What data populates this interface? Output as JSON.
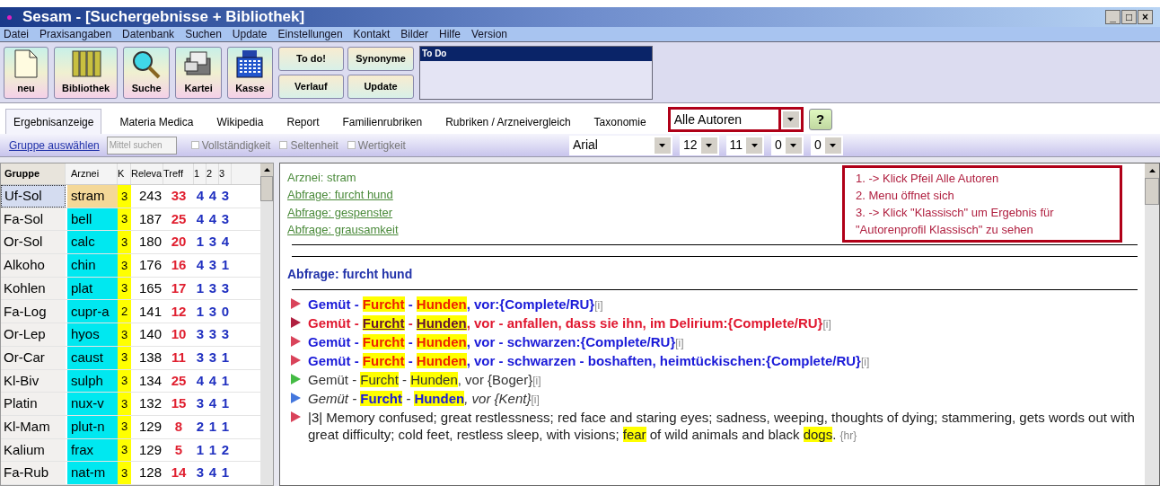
{
  "window": {
    "title": "Sesam - [Suchergebnisse + Bibliothek]",
    "controls": [
      "_",
      "□",
      "×"
    ]
  },
  "menu": [
    "Datei",
    "Praxisangaben",
    "Datenbank",
    "Suchen",
    "Update",
    "Einstellungen",
    "Kontakt",
    "Bilder",
    "Hilfe",
    "Version"
  ],
  "toolbar": {
    "big_buttons": [
      {
        "label": "neu",
        "kind": "page"
      },
      {
        "label": "Bibliothek",
        "kind": "books"
      },
      {
        "label": "Suche",
        "kind": "magnifier"
      },
      {
        "label": "Kartei",
        "kind": "cards"
      },
      {
        "label": "Kasse",
        "kind": "register"
      }
    ],
    "small_buttons": [
      "To do!",
      "Synonyme",
      "Verlauf",
      "Update"
    ],
    "todo_title": "To Do"
  },
  "tabs": [
    {
      "label": "Ergebnisanzeige",
      "selected": true
    },
    {
      "label": "Materia Medica",
      "selected": false
    },
    {
      "label": "Wikipedia",
      "selected": false
    },
    {
      "label": "Report",
      "selected": false
    },
    {
      "label": "Familienrubriken",
      "selected": false
    },
    {
      "label": "Rubriken / Arzneivergleich",
      "selected": false
    },
    {
      "label": "Taxonomie",
      "selected": false
    }
  ],
  "author_select": {
    "value": "Alle Autoren",
    "help": "?"
  },
  "subbar": {
    "link": "Gruppe auswählen",
    "search_placeholder": "Mittel suchen",
    "checkboxes": [
      {
        "label": "Vollständigkeit",
        "checked": false
      },
      {
        "label": "Seltenheit",
        "checked": false
      },
      {
        "label": "Wertigkeit",
        "checked": false
      }
    ],
    "font": "Arial",
    "selects": [
      "12",
      "11",
      "0",
      "0"
    ]
  },
  "table": {
    "columns": [
      "Gruppe",
      "Arznei",
      "K",
      "Releva",
      "Treff",
      "1",
      "2",
      "3"
    ],
    "rows": [
      {
        "gruppe": "Uf-Sol",
        "arznei": "stram",
        "k": "3",
        "releva": "243",
        "treff": "33",
        "c1": "4",
        "c2": "4",
        "c3": "3",
        "selected": true
      },
      {
        "gruppe": "Fa-Sol",
        "arznei": "bell",
        "k": "3",
        "releva": "187",
        "treff": "25",
        "c1": "4",
        "c2": "4",
        "c3": "3",
        "selected": false
      },
      {
        "gruppe": "Or-Sol",
        "arznei": "calc",
        "k": "3",
        "releva": "180",
        "treff": "20",
        "c1": "1",
        "c2": "3",
        "c3": "4",
        "selected": false
      },
      {
        "gruppe": "Alkoho",
        "arznei": "chin",
        "k": "3",
        "releva": "176",
        "treff": "16",
        "c1": "4",
        "c2": "3",
        "c3": "1",
        "selected": false
      },
      {
        "gruppe": "Kohlen",
        "arznei": "plat",
        "k": "3",
        "releva": "165",
        "treff": "17",
        "c1": "1",
        "c2": "3",
        "c3": "3",
        "selected": false
      },
      {
        "gruppe": "Fa-Log",
        "arznei": "cupr-a",
        "k": "2",
        "releva": "141",
        "treff": "12",
        "c1": "1",
        "c2": "3",
        "c3": "0",
        "selected": false
      },
      {
        "gruppe": "Or-Lep",
        "arznei": "hyos",
        "k": "3",
        "releva": "140",
        "treff": "10",
        "c1": "3",
        "c2": "3",
        "c3": "3",
        "selected": false
      },
      {
        "gruppe": "Or-Car",
        "arznei": "caust",
        "k": "3",
        "releva": "138",
        "treff": "11",
        "c1": "3",
        "c2": "3",
        "c3": "1",
        "selected": false
      },
      {
        "gruppe": "Kl-Biv",
        "arznei": "sulph",
        "k": "3",
        "releva": "134",
        "treff": "25",
        "c1": "4",
        "c2": "4",
        "c3": "1",
        "selected": false
      },
      {
        "gruppe": "Platin",
        "arznei": "nux-v",
        "k": "3",
        "releva": "132",
        "treff": "15",
        "c1": "3",
        "c2": "4",
        "c3": "1",
        "selected": false
      },
      {
        "gruppe": "Kl-Mam",
        "arznei": "plut-n",
        "k": "3",
        "releva": "129",
        "treff": "8",
        "c1": "2",
        "c2": "1",
        "c3": "1",
        "selected": false
      },
      {
        "gruppe": "Kalium",
        "arznei": "frax",
        "k": "3",
        "releva": "129",
        "treff": "5",
        "c1": "1",
        "c2": "1",
        "c3": "2",
        "selected": false
      },
      {
        "gruppe": "Fa-Rub",
        "arznei": "nat-m",
        "k": "3",
        "releva": "128",
        "treff": "14",
        "c1": "3",
        "c2": "4",
        "c3": "1",
        "selected": false
      }
    ]
  },
  "content": {
    "remedy": "Arznei: stram",
    "queries": [
      "Abfrage: furcht hund",
      "Abfrage: gespenster",
      "Abfrage: grausamkeit"
    ],
    "note": [
      "1. -> Klick Pfeil Alle Autoren",
      "2. Menu öffnet sich",
      "3. -> Klick \"Klassisch\" um Ergebnis für \"Autorenprofil Klassisch\" zu sehen"
    ],
    "heading": "Abfrage: furcht hund",
    "rubrics": [
      {
        "kind": "bold-blue",
        "color": "#d9435a",
        "parts": [
          {
            "text": "Gemüt - ",
            "hl": false
          },
          {
            "text": "Furcht",
            "hl": true
          },
          {
            "text": " - ",
            "hl": false
          },
          {
            "text": "Hunden",
            "hl": true
          },
          {
            "text": ", vor:{Complete/RU}",
            "hl": false
          }
        ],
        "suffix": "[i]"
      },
      {
        "kind": "bold-red",
        "color": "#b02040",
        "parts": [
          {
            "text": "Gemüt - ",
            "hl": false
          },
          {
            "text": "Furcht",
            "hl": true
          },
          {
            "text": " - ",
            "hl": false
          },
          {
            "text": "Hunden",
            "hl": true
          },
          {
            "text": ", vor - anfallen, dass sie ihn, im Delirium:{Complete/RU}",
            "hl": false
          }
        ],
        "suffix": "[i]"
      },
      {
        "kind": "bold-blue",
        "color": "#d9435a",
        "parts": [
          {
            "text": "Gemüt - ",
            "hl": false
          },
          {
            "text": "Furcht",
            "hl": true
          },
          {
            "text": " - ",
            "hl": false
          },
          {
            "text": "Hunden",
            "hl": true
          },
          {
            "text": ", vor - schwarzen:{Complete/RU}",
            "hl": false
          }
        ],
        "suffix": "[i]"
      },
      {
        "kind": "bold-blue",
        "color": "#d9435a",
        "parts": [
          {
            "text": "Gemüt - ",
            "hl": false
          },
          {
            "text": "Furcht",
            "hl": true
          },
          {
            "text": " - ",
            "hl": false
          },
          {
            "text": "Hunden",
            "hl": true
          },
          {
            "text": ", vor - schwarzen - boshaften, heimtückischen:{Complete/RU}",
            "hl": false
          }
        ],
        "suffix": "[i]"
      },
      {
        "kind": "plain",
        "color": "#44bb44",
        "parts": [
          {
            "text": "Gemüt - ",
            "hl": false
          },
          {
            "text": "Furcht",
            "hl": true
          },
          {
            "text": " - ",
            "hl": false
          },
          {
            "text": "Hunden",
            "hl": true
          },
          {
            "text": ", vor {Boger}",
            "hl": false
          }
        ],
        "suffix": "[i]"
      },
      {
        "kind": "italic",
        "color": "#4477dd",
        "parts": [
          {
            "text": "Gemüt - ",
            "hl": false
          },
          {
            "text": "Furcht",
            "hl": true
          },
          {
            "text": " - ",
            "hl": false
          },
          {
            "text": "Hunden",
            "hl": true
          },
          {
            "text": ", vor {Kent}",
            "hl": false
          }
        ],
        "suffix": "[i]"
      },
      {
        "kind": "text",
        "color": "#d9435a",
        "parts": [
          {
            "text": "|3| Memory confused; great restlessness; red face and staring eyes; sadness, weeping, thoughts of dying; stammering, gets words out with great difficulty; cold feet, restless sleep, with visions; ",
            "hl": false
          },
          {
            "text": "fear",
            "hl": true
          },
          {
            "text": " of wild animals and black ",
            "hl": false
          },
          {
            "text": "dogs",
            "hl": true
          },
          {
            "text": ". ",
            "hl": false
          }
        ],
        "suffix": "{hr}"
      }
    ]
  }
}
